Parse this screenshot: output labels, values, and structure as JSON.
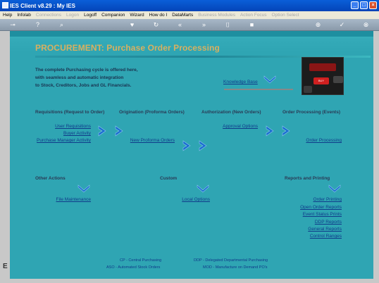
{
  "window": {
    "title": "IES Client v8.29 : My IES"
  },
  "menu": [
    {
      "label": "Help",
      "enabled": true
    },
    {
      "label": "Infolab",
      "enabled": true
    },
    {
      "label": "Connections",
      "enabled": false
    },
    {
      "label": "Logon",
      "enabled": false
    },
    {
      "label": "Logoff",
      "enabled": true
    },
    {
      "label": "Companion",
      "enabled": true
    },
    {
      "label": "Wizard",
      "enabled": true
    },
    {
      "label": "How do I",
      "enabled": true
    },
    {
      "label": "DataMarts",
      "enabled": true
    },
    {
      "label": "Business Modules",
      "enabled": false
    },
    {
      "label": "Action Focus",
      "enabled": false
    },
    {
      "label": "Option Select",
      "enabled": false
    }
  ],
  "toolbar_icons": [
    "key-icon",
    "help-icon",
    "search-icon",
    "heart-icon",
    "refresh-icon",
    "rewind-icon",
    "forward-icon",
    "bookmark-icon",
    "stop-icon",
    "add-icon",
    "check-icon",
    "close-icon"
  ],
  "page": {
    "title": "PROCUREMENT: Purchase Order Processing",
    "intro_lines": [
      "The complete Purchasing cycle is offered here,",
      "with seamless and automatic integration",
      "to Stock, Creditors, Jobs and GL Financials."
    ],
    "knowledge_base": "Knowledge Base",
    "photo_key_text": "BUY"
  },
  "sections": {
    "requisitions": {
      "heading": "Requisitions (Request to Order)",
      "links": [
        "User Requisitions",
        "Buyer Activity",
        "Purchase Manager Activity"
      ]
    },
    "origination": {
      "heading": "Origination (Proforma Orders)",
      "links": [
        "New Proforma Orders"
      ]
    },
    "authorization": {
      "heading": "Authorization (New Orders)",
      "links": [
        "Approval Options"
      ]
    },
    "order_processing": {
      "heading": "Order Processing (Events)",
      "links": [
        "Order Processing"
      ]
    },
    "other_actions": {
      "heading": "Other Actions",
      "links": [
        "File Maintenance"
      ]
    },
    "custom": {
      "heading": "Custom",
      "links": [
        "Local Options"
      ]
    },
    "reports": {
      "heading": "Reports and Printing",
      "links": [
        "Order Printing",
        "Open Order Reports",
        "Event Status Prints",
        "DDP Reports",
        "General Reports",
        "Control Ranges"
      ]
    }
  },
  "legend": [
    "CP - Central Purchasing",
    "ASO - Automated Stock Orders",
    "DDP - Delegated Departmental Purchasing",
    "MOD - Manufacture on Demand PO's"
  ],
  "colors": {
    "panel": "#2fa5b3",
    "title": "#d8b060",
    "link": "#103a8a",
    "heading": "#2a3a55",
    "arrow": "#1a6fd0"
  }
}
